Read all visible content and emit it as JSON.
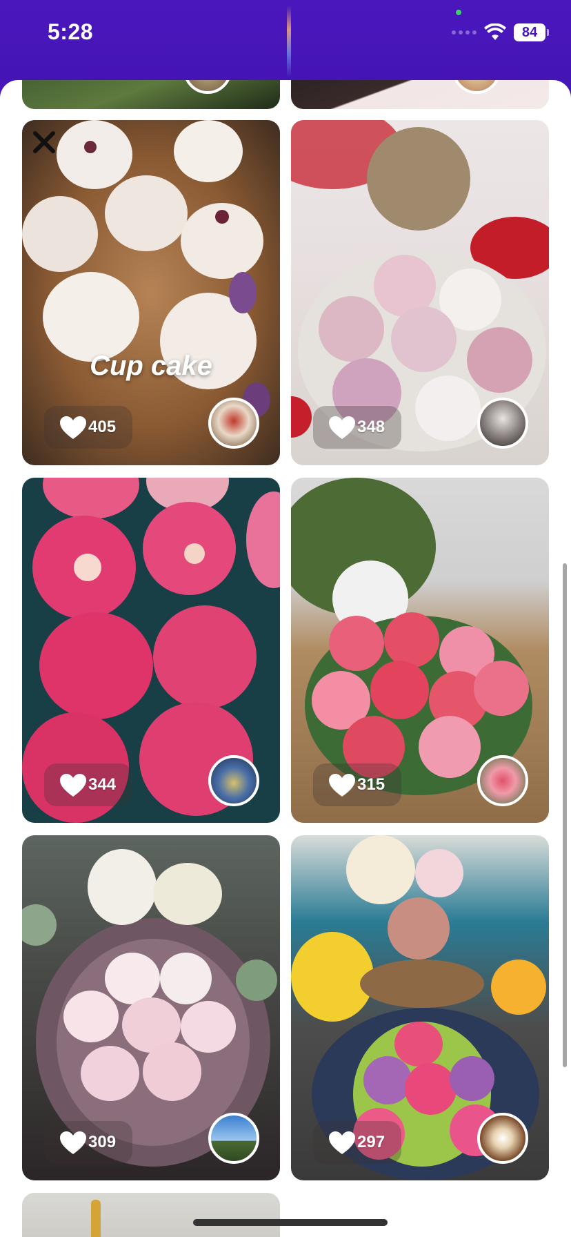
{
  "status_bar": {
    "time": "5:28",
    "battery": "84"
  },
  "feed": {
    "cards": [
      {
        "likes": "405",
        "title": "Cup cake"
      },
      {
        "likes": "348"
      },
      {
        "likes": "344"
      },
      {
        "likes": "315"
      },
      {
        "likes": "309"
      },
      {
        "likes": "297"
      }
    ]
  },
  "colors": {
    "header": "#4716b8",
    "sheet": "#ffffff"
  }
}
